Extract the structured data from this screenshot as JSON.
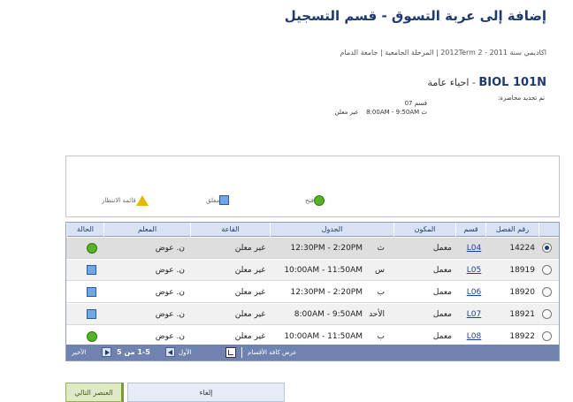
{
  "page": {
    "title": "إضافة إلى عربة التسوق - قسم التسجيل",
    "breadcrumb": "اكاديمي سنة 2011 - 2012Term 2 | المرحلة الجامعية | جامعة الدمام"
  },
  "course": {
    "code": "BIOL  101N",
    "name": "- احياء عامة",
    "schedule_note": "تم تحديد محاضرة:",
    "section_label": "قسم 07",
    "meeting_day": "ث",
    "meeting_time": "8:00AM - 9:50AM",
    "meeting_room": "غير معلن"
  },
  "legend": {
    "open": "فتح",
    "closed": "مغلق",
    "waitlist": "قائمة الانتظار"
  },
  "colors": {
    "open": "#55b324",
    "closed": "#6fa8e8",
    "waitlist": "#e8b800",
    "title": "#1d3a73",
    "link": "#1a3fb0"
  },
  "table": {
    "headers": {
      "class_number": "رقم الفصل",
      "section": "قسم",
      "component": "المكون",
      "schedule": "الجدول",
      "room": "القاعة",
      "instructor": "المعلم",
      "status": "الحالة"
    },
    "rows": [
      {
        "selected": true,
        "class_number": "14224",
        "section": "L04",
        "component": "معمل",
        "day": "ث",
        "time": "12:30PM - 2:20PM",
        "room": "غير معلن",
        "instructor": "ن. عوض",
        "status": "open"
      },
      {
        "selected": false,
        "class_number": "18919",
        "section": "L05",
        "component": "معمل",
        "day": "س",
        "time": "10:00AM - 11:50AM",
        "room": "غير معلن",
        "instructor": "ن. عوض",
        "status": "closed"
      },
      {
        "selected": false,
        "class_number": "18920",
        "section": "L06",
        "component": "معمل",
        "day": "ب",
        "time": "12:30PM - 2:20PM",
        "room": "غير معلن",
        "instructor": "ن. عوض",
        "status": "closed"
      },
      {
        "selected": false,
        "class_number": "18921",
        "section": "L07",
        "component": "معمل",
        "day": "الأحد",
        "time": "8:00AM - 9:50AM",
        "room": "غير معلن",
        "instructor": "ن. عوض",
        "status": "closed"
      },
      {
        "selected": false,
        "class_number": "18922",
        "section": "L08",
        "component": "معمل",
        "day": "ب",
        "time": "10:00AM - 11:50AM",
        "room": "غير معلن",
        "instructor": "ن. عوض",
        "status": "open"
      }
    ],
    "footer": {
      "view_all": "عرض كافة الأقسام",
      "first": "الأول",
      "range": "1-5 من 5",
      "last": "الأخير"
    }
  },
  "buttons": {
    "cancel": "إلغاء",
    "next": "العنصر التالي"
  }
}
